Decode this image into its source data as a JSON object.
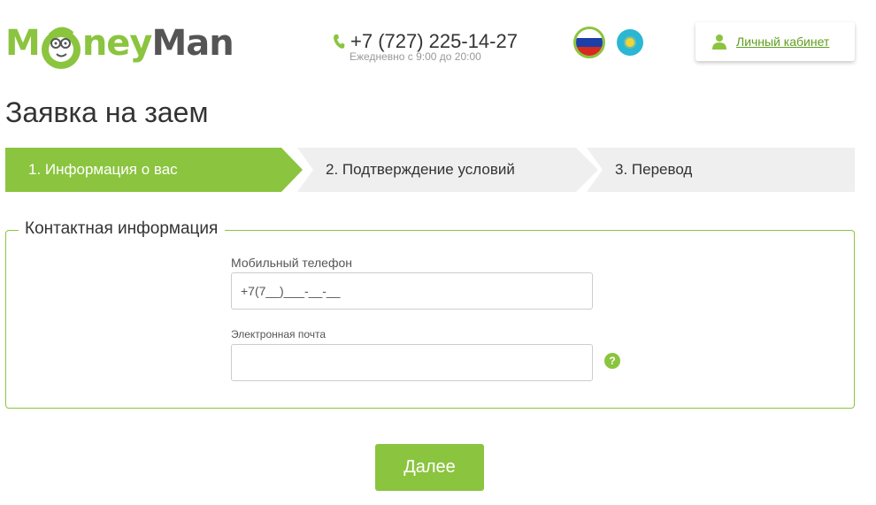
{
  "header": {
    "logo": {
      "m": "M",
      "rest": "ney",
      "man": "Man"
    },
    "phone": {
      "number": "+7 (727) 225-14-27",
      "hours": "Ежедневно с 9:00 до 20:00"
    },
    "languages": [
      {
        "name": "russian-flag",
        "selected": true
      },
      {
        "name": "kazakhstan-flag",
        "selected": false
      }
    ],
    "cabinet_label": "Личный кабинет"
  },
  "page_title": "Заявка на заем",
  "steps": [
    {
      "label": "1. Информация о вас",
      "active": true
    },
    {
      "label": "2. Подтверждение условий",
      "active": false
    },
    {
      "label": "3. Перевод",
      "active": false
    }
  ],
  "contact": {
    "legend": "Контактная информация",
    "phone_label": "Мобильный телефон",
    "phone_value": "+7(7__)___-__-__",
    "email_label": "Электронная почта",
    "email_value": "",
    "help": "?"
  },
  "next_label": "Далее",
  "colors": {
    "accent": "#8bc43f",
    "link": "#5f9e1f",
    "step_inactive": "#efefef"
  }
}
